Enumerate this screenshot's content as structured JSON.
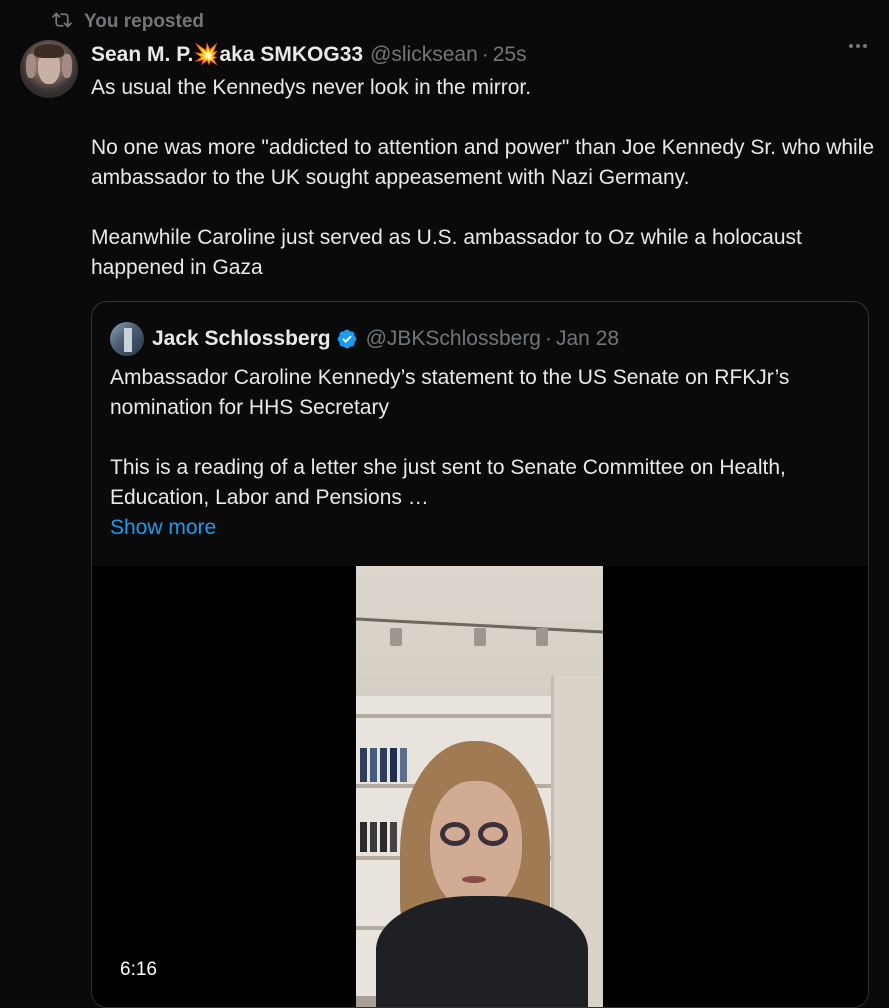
{
  "repost": {
    "label": "You reposted",
    "icon": "repost-icon"
  },
  "tweet": {
    "author_name": "Sean M. P.",
    "author_emoji": "💥",
    "author_name_suffix": "aka SMKOG33",
    "handle": "@slicksean",
    "separator": "·",
    "time": "25s",
    "paragraphs": [
      "As usual the Kennedys never look in the mirror.",
      "No one was more \"addicted to attention and power\" than Joe Kennedy Sr. who while ambassador to the UK sought appeasement with Nazi Germany.",
      "Meanwhile Caroline just served as U.S. ambassador to Oz while a holocaust happened in Gaza"
    ]
  },
  "quote": {
    "author_name": "Jack Schlossberg",
    "verified_icon": "verified-badge-icon",
    "handle": "@JBKSchlossberg",
    "separator": "·",
    "date": "Jan 28",
    "paragraphs": [
      "Ambassador Caroline Kennedy’s statement to the US Senate on RFKJr’s nomination for HHS Secretary",
      "This is a reading of a letter she just sent to Senate Committee on Health, Education, Labor and Pensions …"
    ],
    "show_more": "Show more",
    "video": {
      "duration": "6:16"
    }
  },
  "colors": {
    "background": "#0a0a0a",
    "text": "#e7e9ea",
    "muted": "#71767b",
    "link": "#1d9bf0",
    "border": "#2f3336",
    "verified": "#1d9bf0"
  }
}
